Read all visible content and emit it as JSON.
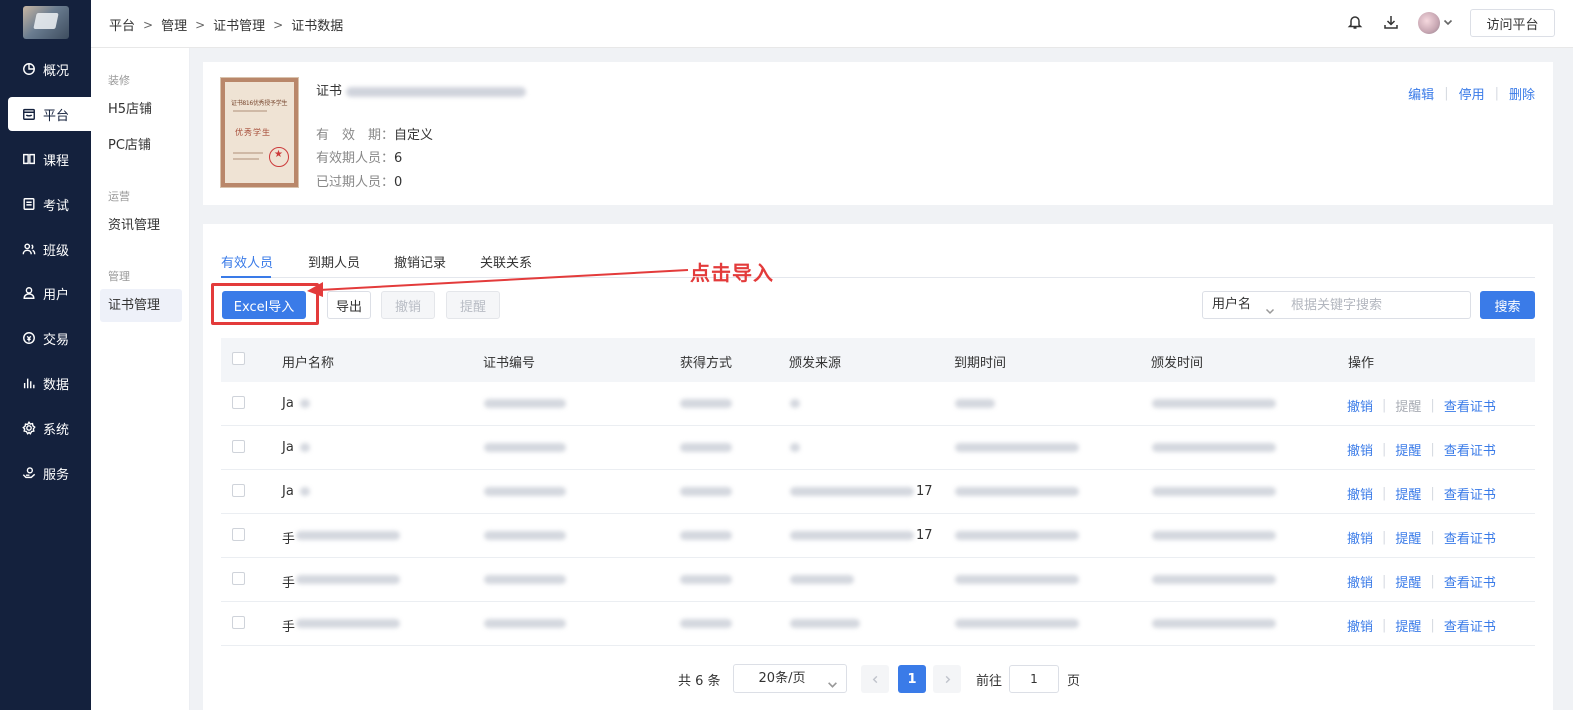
{
  "nav": {
    "items": [
      {
        "label": "概况",
        "icon": "pie-chart-icon"
      },
      {
        "label": "平台",
        "icon": "store-icon"
      },
      {
        "label": "课程",
        "icon": "book-icon"
      },
      {
        "label": "考试",
        "icon": "exam-icon"
      },
      {
        "label": "班级",
        "icon": "class-icon"
      },
      {
        "label": "用户",
        "icon": "user-icon"
      },
      {
        "label": "交易",
        "icon": "trade-icon"
      },
      {
        "label": "数据",
        "icon": "bar-chart-icon"
      },
      {
        "label": "系统",
        "icon": "gear-icon"
      },
      {
        "label": "服务",
        "icon": "service-icon"
      }
    ],
    "active": "平台"
  },
  "subnav": {
    "groups": [
      {
        "label": "装修",
        "items": [
          "H5店铺",
          "PC店铺"
        ]
      },
      {
        "label": "运营",
        "items": [
          "资讯管理"
        ]
      },
      {
        "label": "管理",
        "items": [
          "证书管理"
        ]
      }
    ],
    "active": "证书管理"
  },
  "header": {
    "breadcrumb": [
      "平台",
      "管理",
      "证书管理",
      "证书数据"
    ],
    "visit_label": "访问平台",
    "icons": [
      "bell-icon",
      "download-icon",
      "avatar",
      "chevron-down-icon"
    ]
  },
  "certificate": {
    "title_prefix": "证书",
    "image_text_top": "证书816优秀授予学生",
    "image_text_main": "优秀学生",
    "validity_label": "有　效　期：",
    "validity_value": "自定义",
    "valid_count_label": "有效期人员：",
    "valid_count": "6",
    "expired_count_label": "已过期人员：",
    "expired_count": "0",
    "actions": [
      "编辑",
      "停用",
      "删除"
    ]
  },
  "tabs": [
    "有效人员",
    "到期人员",
    "撤销记录",
    "关联关系"
  ],
  "toolbar": {
    "import_label": "Excel导入",
    "export_label": "导出",
    "revoke_label": "撤销",
    "remind_label": "提醒",
    "annotation": "点击导入",
    "search_field": "用户名",
    "search_placeholder": "根据关键字搜索",
    "search_button": "搜索"
  },
  "table": {
    "columns": [
      "用户名称",
      "证书编号",
      "获得方式",
      "颁发来源",
      "到期时间",
      "颁发时间",
      "操作"
    ],
    "rows": [
      {
        "name_prefix": "Ja",
        "source_suffix": "",
        "remind_enabled": false
      },
      {
        "name_prefix": "Ja",
        "source_suffix": "",
        "remind_enabled": true
      },
      {
        "name_prefix": "Ja",
        "source_suffix": "17",
        "remind_enabled": true
      },
      {
        "name_prefix": "手",
        "source_suffix": "17",
        "remind_enabled": true
      },
      {
        "name_prefix": "手",
        "source_suffix": "",
        "remind_enabled": true
      },
      {
        "name_prefix": "手",
        "source_suffix": "",
        "remind_enabled": true
      }
    ],
    "row_actions": [
      "撤销",
      "提醒",
      "查看证书"
    ]
  },
  "pagination": {
    "total_label": "共 6 条",
    "page_size": "20条/页",
    "current_page": "1",
    "goto_label": "前往",
    "goto_value": "1",
    "page_suffix": "页"
  },
  "colors": {
    "nav_bg": "#14213d",
    "accent": "#3a7be8",
    "annotation": "#e33b3b"
  }
}
